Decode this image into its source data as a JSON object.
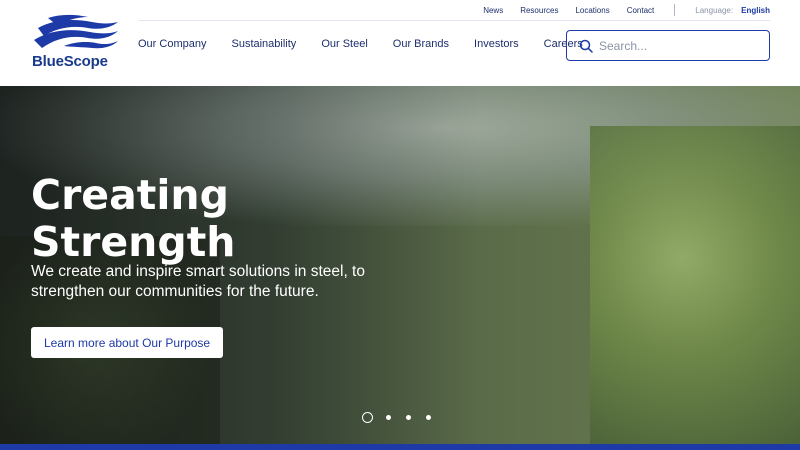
{
  "brand": {
    "name": "BlueScope",
    "color": "#1d3aa6"
  },
  "utility_nav": {
    "links": [
      "News",
      "Resources",
      "Locations",
      "Contact"
    ],
    "language_label": "Language:",
    "language_value": "English"
  },
  "main_nav": {
    "items": [
      "Our Company",
      "Sustainability",
      "Our Steel",
      "Our Brands",
      "Investors",
      "Careers"
    ]
  },
  "search": {
    "placeholder": "Search...",
    "icon": "search-icon"
  },
  "hero": {
    "title_line1": "Creating",
    "title_line2": "Strength",
    "subtitle_line1": "We create and inspire smart solutions in steel, to",
    "subtitle_line2": "strengthen our communities for the future.",
    "cta_label": "Learn more about Our Purpose"
  },
  "carousel": {
    "slide_count": 4,
    "active_index": 0
  }
}
